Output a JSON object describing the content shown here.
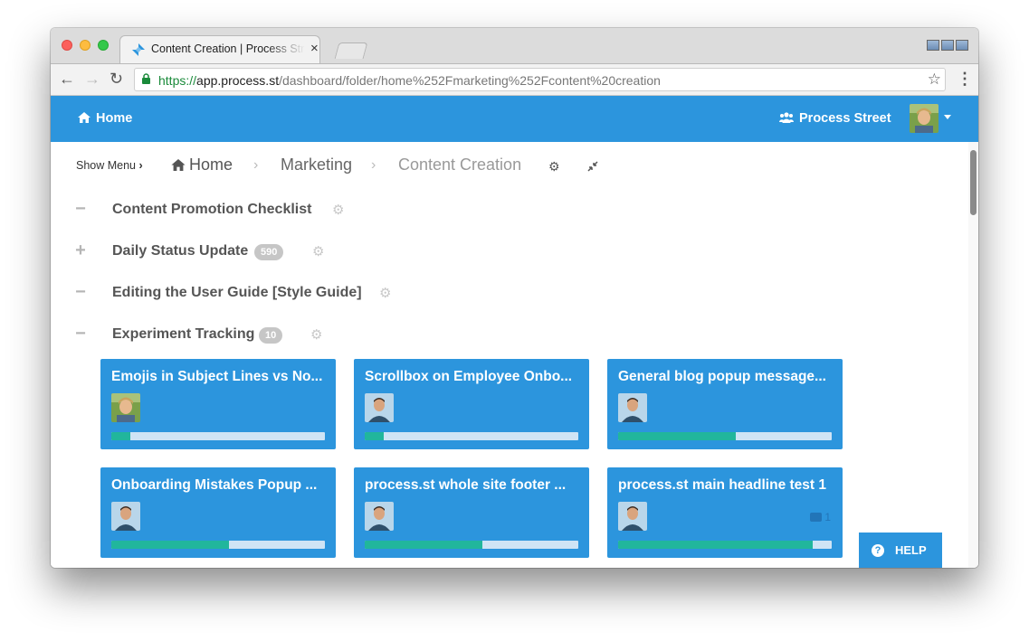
{
  "browser": {
    "tab_title": "Content Creation | Process Street",
    "tab_close": "×",
    "url_scheme": "https://",
    "url_host": "app.process.st",
    "url_path": "/dashboard/folder/home%252Fmarketing%252Fcontent%20creation"
  },
  "topnav": {
    "home_label": "Home",
    "org_label": "Process Street"
  },
  "breadcrumb": {
    "show_menu": "Show Menu",
    "items": [
      "Home",
      "Marketing",
      "Content Creation"
    ]
  },
  "folders": [
    {
      "toggle": "−",
      "name": "Content Promotion Checklist",
      "count": ""
    },
    {
      "toggle": "+",
      "name": "Daily Status Update",
      "count": "590"
    },
    {
      "toggle": "−",
      "name": "Editing the User Guide [Style Guide]",
      "count": ""
    },
    {
      "toggle": "−",
      "name": "Experiment Tracking",
      "count": "10"
    }
  ],
  "cards": [
    {
      "title": "Emojis in Subject Lines vs No...",
      "progress": 0.09,
      "avatar": "blond",
      "comments": ""
    },
    {
      "title": "Scrollbox on Employee Onbo...",
      "progress": 0.09,
      "avatar": "dark",
      "comments": ""
    },
    {
      "title": "General blog popup message...",
      "progress": 0.55,
      "avatar": "dark",
      "comments": ""
    },
    {
      "title": "Onboarding Mistakes Popup ...",
      "progress": 0.55,
      "avatar": "dark",
      "comments": ""
    },
    {
      "title": "process.st whole site footer ...",
      "progress": 0.55,
      "avatar": "dark",
      "comments": ""
    },
    {
      "title": "process.st main headline test 1",
      "progress": 0.91,
      "avatar": "dark",
      "comments": "1"
    }
  ],
  "help": {
    "label": "HELP",
    "icon": "?"
  },
  "colors": {
    "brand_blue": "#2c95dd",
    "progress_green": "#21b69c",
    "badge_gray": "#c6c6c6"
  }
}
